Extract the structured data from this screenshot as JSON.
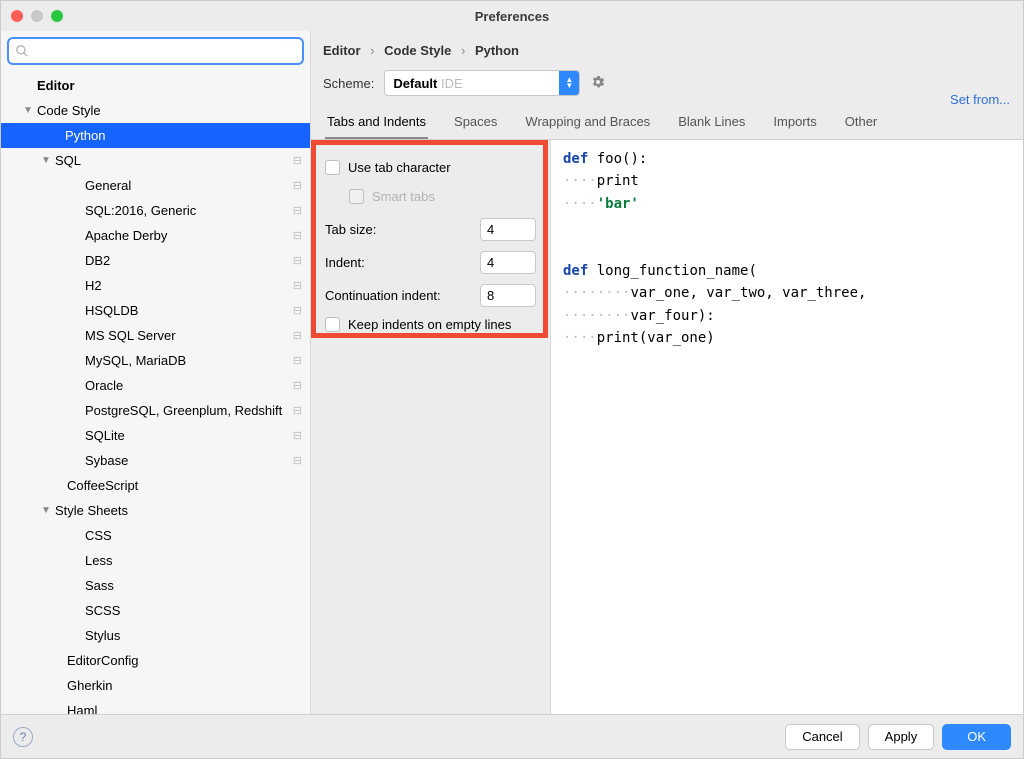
{
  "title": "Preferences",
  "search": {
    "placeholder": ""
  },
  "tree": [
    {
      "label": "Editor",
      "indent": 28,
      "arrow": "",
      "bold": true
    },
    {
      "label": "Code Style",
      "indent": 28,
      "arrow": "▼",
      "meta": ""
    },
    {
      "label": "Python",
      "indent": 56,
      "selected": true
    },
    {
      "label": "SQL",
      "indent": 46,
      "arrow": "▼",
      "meta": "⊟"
    },
    {
      "label": "General",
      "indent": 76,
      "meta": "⊟"
    },
    {
      "label": "SQL:2016, Generic",
      "indent": 76,
      "meta": "⊟"
    },
    {
      "label": "Apache Derby",
      "indent": 76,
      "meta": "⊟"
    },
    {
      "label": "DB2",
      "indent": 76,
      "meta": "⊟"
    },
    {
      "label": "H2",
      "indent": 76,
      "meta": "⊟"
    },
    {
      "label": "HSQLDB",
      "indent": 76,
      "meta": "⊟"
    },
    {
      "label": "MS SQL Server",
      "indent": 76,
      "meta": "⊟"
    },
    {
      "label": "MySQL, MariaDB",
      "indent": 76,
      "meta": "⊟"
    },
    {
      "label": "Oracle",
      "indent": 76,
      "meta": "⊟"
    },
    {
      "label": "PostgreSQL, Greenplum, Redshift",
      "indent": 76,
      "meta": "⊟"
    },
    {
      "label": "SQLite",
      "indent": 76,
      "meta": "⊟"
    },
    {
      "label": "Sybase",
      "indent": 76,
      "meta": "⊟"
    },
    {
      "label": "CoffeeScript",
      "indent": 58
    },
    {
      "label": "Style Sheets",
      "indent": 46,
      "arrow": "▼"
    },
    {
      "label": "CSS",
      "indent": 76
    },
    {
      "label": "Less",
      "indent": 76
    },
    {
      "label": "Sass",
      "indent": 76
    },
    {
      "label": "SCSS",
      "indent": 76
    },
    {
      "label": "Stylus",
      "indent": 76
    },
    {
      "label": "EditorConfig",
      "indent": 58
    },
    {
      "label": "Gherkin",
      "indent": 58
    },
    {
      "label": "Haml",
      "indent": 58
    }
  ],
  "breadcrumbs": [
    "Editor",
    "Code Style",
    "Python"
  ],
  "scheme": {
    "label": "Scheme:",
    "value_main": "Default",
    "value_sub": "IDE"
  },
  "setfrom": "Set from...",
  "tabs": [
    "Tabs and Indents",
    "Spaces",
    "Wrapping and Braces",
    "Blank Lines",
    "Imports",
    "Other"
  ],
  "settings": {
    "use_tab": "Use tab character",
    "smart_tabs": "Smart tabs",
    "tab_size_label": "Tab size:",
    "tab_size": "4",
    "indent_label": "Indent:",
    "indent": "4",
    "cont_indent_label": "Continuation indent:",
    "cont_indent": "8",
    "keep_indents": "Keep indents on empty lines"
  },
  "preview": {
    "l1_kw": "def",
    "l1_rest": " foo():",
    "l2_d": "····",
    "l2_r": "print",
    "l3_d": "····",
    "l3_s": "'bar'",
    "l5_kw": "def",
    "l5_rest": " long_function_name(",
    "l6_d": "········",
    "l6_r": "var_one, var_two, var_three,",
    "l7_d": "········",
    "l7_r": "var_four):",
    "l8_d": "····",
    "l8_r": "print(var_one)"
  },
  "footer": {
    "cancel": "Cancel",
    "apply": "Apply",
    "ok": "OK"
  }
}
